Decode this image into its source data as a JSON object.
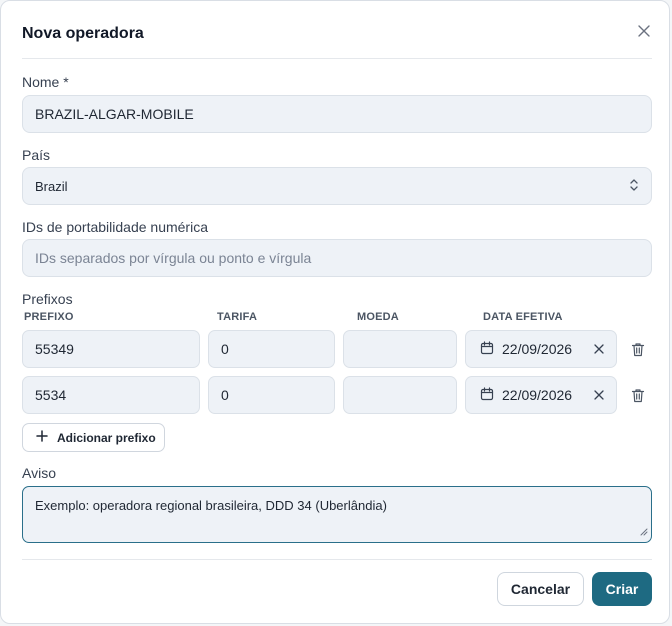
{
  "dialog": {
    "title": "Nova operadora",
    "close_icon": "close-icon"
  },
  "name_field": {
    "label": "Nome *",
    "value": "BRAZIL-ALGAR-MOBILE"
  },
  "country_field": {
    "label": "País",
    "value": "Brazil"
  },
  "portability_field": {
    "label": "IDs de portabilidade numérica",
    "placeholder": "IDs separados por vírgula ou ponto e vírgula"
  },
  "prefixes": {
    "section_label": "Prefixos",
    "columns": [
      "PREFIXO",
      "TARIFA",
      "MOEDA",
      "DATA EFETIVA"
    ],
    "rows": [
      {
        "prefix": "55349",
        "rate": "0",
        "currency": "",
        "date": "22/09/2026"
      },
      {
        "prefix": "5534",
        "rate": "0",
        "currency": "",
        "date": "22/09/2026"
      }
    ],
    "add_label": "Adicionar prefixo"
  },
  "notice_field": {
    "label": "Aviso",
    "value": "Exemplo: operadora regional brasileira, DDD 34 (Uberlândia)"
  },
  "footer": {
    "cancel_label": "Cancelar",
    "create_label": "Criar"
  },
  "colors": {
    "primary": "#1e6a82",
    "focus_border": "#2a6f8a",
    "field_bg": "#eef2f7"
  }
}
